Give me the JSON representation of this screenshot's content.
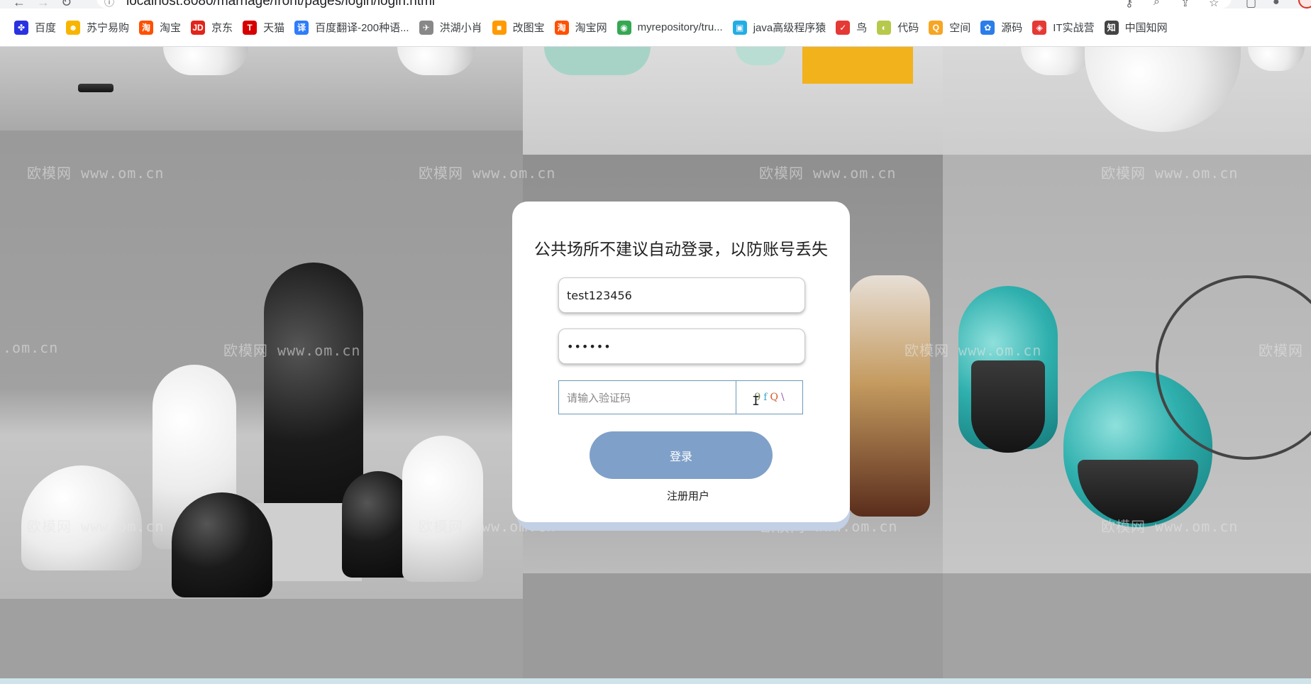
{
  "browser": {
    "url": "localhost:8080/marriage/front/pages/login/login.html",
    "bookmarks": [
      {
        "label": "百度",
        "icon": "baidu-paw-icon",
        "color": "#2932e1",
        "glyph": "✤"
      },
      {
        "label": "苏宁易购",
        "icon": "suning-icon",
        "color": "#f7b500",
        "glyph": "☻"
      },
      {
        "label": "淘宝",
        "icon": "taobao-icon",
        "color": "#ff5000",
        "glyph": "淘"
      },
      {
        "label": "京东",
        "icon": "jd-icon",
        "color": "#e1251b",
        "glyph": "JD"
      },
      {
        "label": "天猫",
        "icon": "tmall-icon",
        "color": "#d60000",
        "glyph": "T"
      },
      {
        "label": "百度翻译-200种语...",
        "icon": "baidu-translate-icon",
        "color": "#2f7dfa",
        "glyph": "译"
      },
      {
        "label": "洪湖小肖",
        "icon": "bird-icon",
        "color": "#888888",
        "glyph": "✈"
      },
      {
        "label": "改图宝",
        "icon": "gaitubao-icon",
        "color": "#ff9a00",
        "glyph": "■"
      },
      {
        "label": "淘宝网",
        "icon": "taobao-icon",
        "color": "#ff5000",
        "glyph": "淘"
      },
      {
        "label": "myrepository/tru...",
        "icon": "chrome-icon",
        "color": "#34a853",
        "glyph": "◉"
      },
      {
        "label": "java高级程序猿",
        "icon": "bilibili-icon",
        "color": "#23ade5",
        "glyph": "▣"
      },
      {
        "label": "鸟",
        "icon": "bird-red-icon",
        "color": "#e53935",
        "glyph": "✓"
      },
      {
        "label": "代码",
        "icon": "code-icon",
        "color": "#b7c94a",
        "glyph": "◐"
      },
      {
        "label": "空间",
        "icon": "qzone-icon",
        "color": "#f6a623",
        "glyph": "Q"
      },
      {
        "label": "源码",
        "icon": "gitee-icon",
        "color": "#2b7de9",
        "glyph": "✿"
      },
      {
        "label": "IT实战营",
        "icon": "it-icon",
        "color": "#e53935",
        "glyph": "◈"
      },
      {
        "label": "中国知网",
        "icon": "cnki-icon",
        "color": "#444444",
        "glyph": "知"
      }
    ]
  },
  "watermark": "欧模网 www.om.cn",
  "watermark_partial": ".om.cn",
  "login": {
    "title": "公共场所不建议自动登录，以防账号丢失",
    "username_value": "test123456",
    "password_value": "••••••",
    "captcha_placeholder": "请输入验证码",
    "captcha_chars": [
      "9",
      "f",
      "Q",
      "\\"
    ],
    "login_button": "登录",
    "register_link": "注册用户"
  },
  "colors": {
    "login_button": "#7fa0c8",
    "captcha_border": "#6a9bb8",
    "card_shadow": "#c2cfe4"
  }
}
